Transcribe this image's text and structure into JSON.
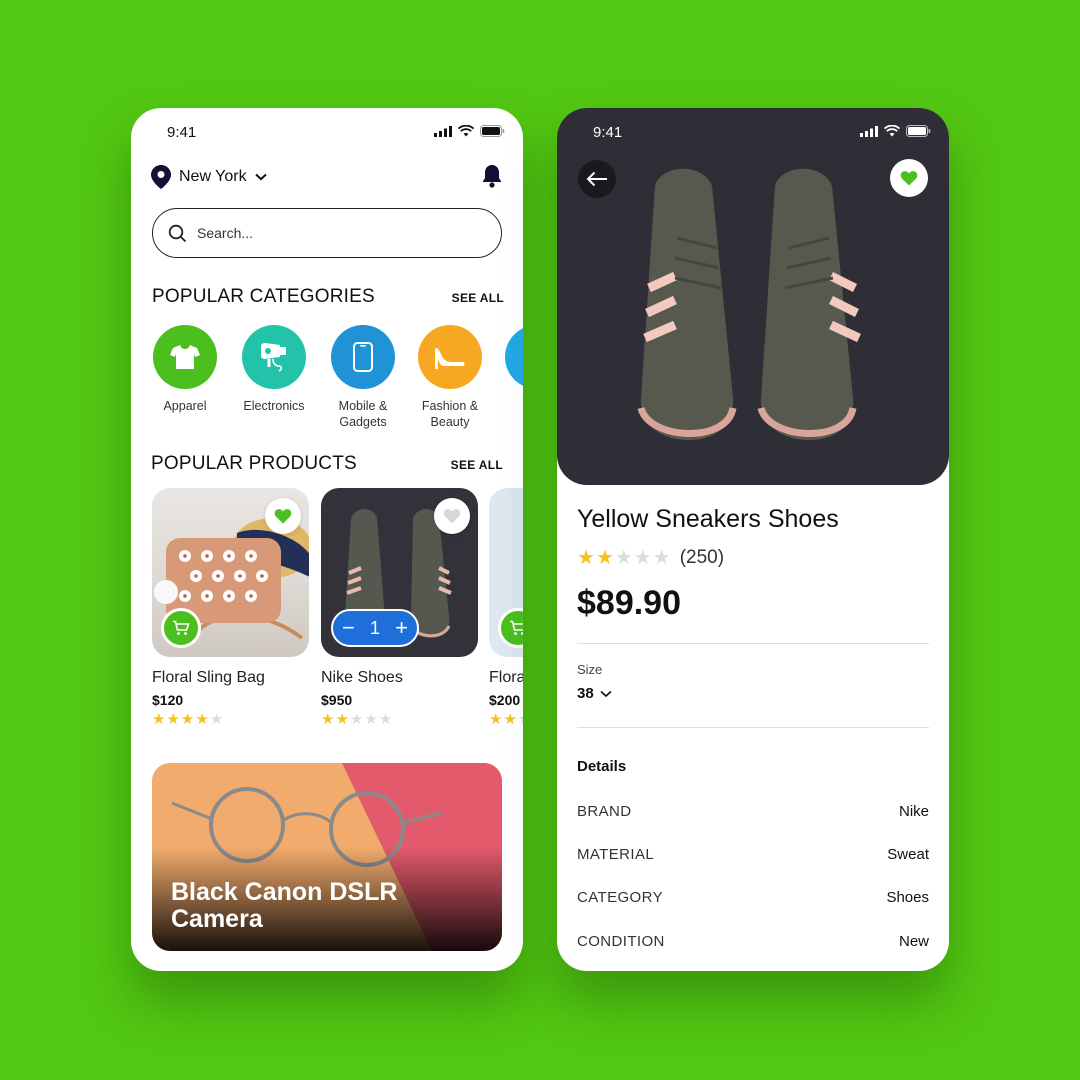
{
  "colors": {
    "background": "#52c812",
    "accent_green": "#4bbf1e",
    "qty_blue": "#1e6fd9",
    "star": "#f7c21b"
  },
  "left_screen": {
    "status_time": "9:41",
    "location": "New York",
    "search_placeholder": "Search...",
    "categories_section": {
      "title": "POPULAR CATEGORIES",
      "see_all": "SEE ALL",
      "items": [
        {
          "label": "Apparel",
          "icon": "tshirt-icon",
          "color": "#4bbf1e"
        },
        {
          "label": "Electronics",
          "icon": "hairdryer-icon",
          "color": "#22c3a8"
        },
        {
          "label": "Mobile & Gadgets",
          "icon": "smartphone-icon",
          "color": "#1f93d6"
        },
        {
          "label": "Fashion & Beauty",
          "icon": "high-heel-icon",
          "color": "#f6a823"
        }
      ]
    },
    "products_section": {
      "title": "POPULAR PRODUCTS",
      "see_all": "SEE ALL",
      "items": [
        {
          "name": "Floral Sling Bag",
          "price": "$120",
          "rating": 4,
          "favorited": true
        },
        {
          "name": "Nike Shoes",
          "price": "$950",
          "rating": 2,
          "favorited": false,
          "quantity": "1"
        },
        {
          "name": "Flora",
          "price": "$200",
          "rating": 2
        }
      ]
    },
    "banner": {
      "title": "Black Canon DSLR Camera"
    }
  },
  "right_screen": {
    "status_time": "9:41",
    "product_title": "Yellow Sneakers Shoes",
    "rating": 2,
    "rating_count": "(250)",
    "price": "$89.90",
    "size_label": "Size",
    "size_value": "38",
    "details_heading": "Details",
    "specs": [
      {
        "key": "BRAND",
        "value": "Nike"
      },
      {
        "key": "MATERIAL",
        "value": "Sweat"
      },
      {
        "key": "CATEGORY",
        "value": "Shoes"
      },
      {
        "key": "CONDITION",
        "value": "New"
      }
    ]
  }
}
